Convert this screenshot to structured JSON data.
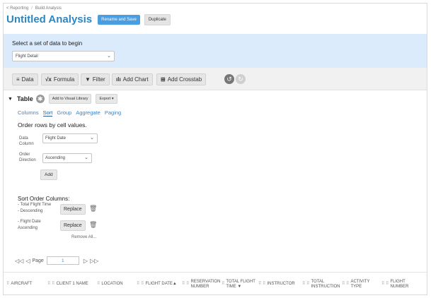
{
  "breadcrumb": {
    "root": "< Reporting",
    "sep": "/",
    "current": "Build Analysis"
  },
  "header": {
    "title": "Untitled Analysis",
    "rename_label": "Rename and Save",
    "duplicate_label": "Duplicate"
  },
  "dataset": {
    "label": "Select a set of data to begin",
    "selected": "Flight Detail"
  },
  "toolbar": {
    "data_label": "Data",
    "formula_label": "Formula",
    "filter_label": "Filter",
    "add_chart_label": "Add Chart",
    "add_crosstab_label": "Add Crosstab"
  },
  "table": {
    "title": "Table",
    "add_library_label": "Add to Visual Library",
    "export_label": "Export ▾"
  },
  "subtabs": [
    {
      "label": "Columns"
    },
    {
      "label": "Sort"
    },
    {
      "label": "Group"
    },
    {
      "label": "Aggregate"
    },
    {
      "label": "Paging"
    }
  ],
  "sort": {
    "title": "Order rows by cell values.",
    "data_column_label": "Data Column",
    "data_column_value": "Flight Date",
    "order_direction_label": "Order Direction",
    "order_direction_value": "Ascending",
    "add_label": "Add"
  },
  "sort_order": {
    "title": "Sort Order Columns:",
    "items": [
      {
        "name": "- Total Flight Time",
        "direction": "- Descending"
      },
      {
        "name": "- Flight Date",
        "direction": "Ascending"
      }
    ],
    "replace_label": "Replace",
    "remove_all_label": "Remove All..."
  },
  "pager": {
    "label": "Page",
    "value": "1"
  },
  "columns": [
    {
      "label": "AIRCRAFT"
    },
    {
      "label": "CLIENT 1 NAME"
    },
    {
      "label": "LOCATION"
    },
    {
      "label": "FLIGHT DATE▲"
    },
    {
      "label": "RESERVATION NUMBER"
    },
    {
      "label": "TOTAL FLIGHT TIME ▼"
    },
    {
      "label": "INSTRUCTOR"
    },
    {
      "label": "TOTAL INSTRUCTION"
    },
    {
      "label": "ACTIVITY TYPE"
    },
    {
      "label": "FLIGHT NUMBER"
    }
  ],
  "colors": {
    "accent": "#2e86c1",
    "dataset_bg": "#dcebfb",
    "button_primary": "#4a9de0"
  }
}
